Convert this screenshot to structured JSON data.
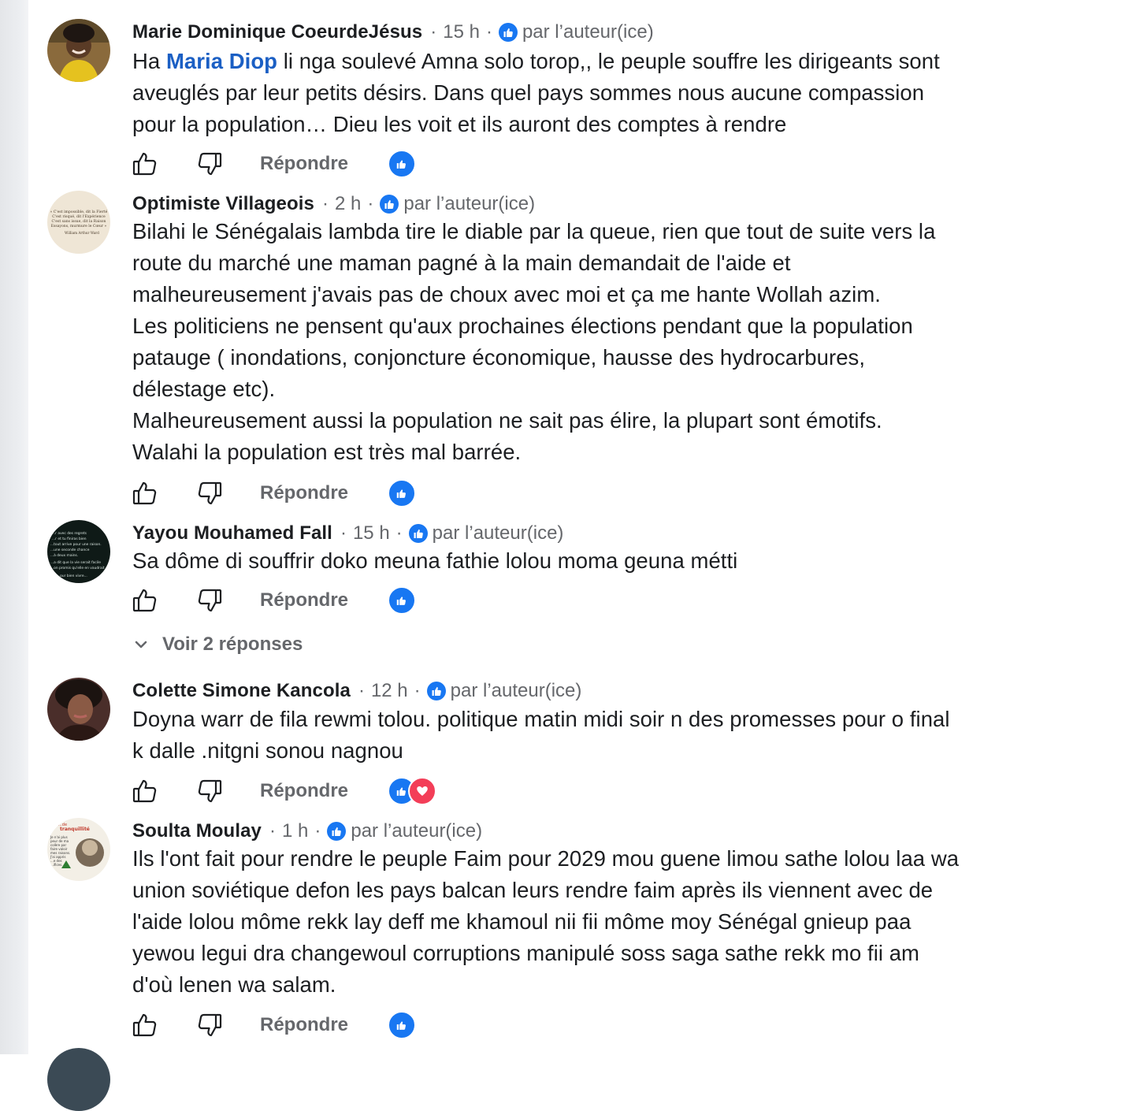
{
  "badge_text": "par l’auteur(ice)",
  "separator": "·",
  "reply_label": "Répondre",
  "colors": {
    "brand_blue": "#1877f2",
    "mention": "#1b5fc4",
    "meta_gray": "#65676b",
    "love_red": "#f33e58"
  },
  "avatar_art": {
    "quote": [
      "« C'est impossible, dit la Fierté",
      "C'est risqué, dit l'Expérience",
      "C'est sans issue, dit la Raison",
      "Essayons, murmure le Cœur »",
      "William Arthur Ward"
    ],
    "board": [
      "...r avec des regrets",
      "...r et tu finiras bien",
      "...tout arrive pour une raison.",
      "...une seconde chance",
      "...à deux mains.",
      "...a dit que la vie serait facile",
      "...on promis qu'elle en vaudrait",
      "...our bien vivre..."
    ],
    "poster": [
      "...de",
      "tranquillité",
      "Je n'ai plus",
      "peur de ma",
      "colère par",
      "faire valoir",
      "mes raisons.",
      "J'ai appris",
      "...e des",
      "...ifices."
    ]
  },
  "comments": [
    {
      "author": "Marie Dominique CoeurdeJésus",
      "time": "15 h",
      "lines": [
        {
          "pre": "Ha ",
          "mention": "Maria Diop",
          "post": " li nga soulevé Amna solo torop,, le peuple souffre les dirigeants sont"
        },
        {
          "pre": "aveuglés par leur petits désirs. Dans quel pays sommes nous aucune compassion"
        },
        {
          "pre": "pour la population… Dieu les voit et ils auront des comptes à rendre"
        }
      ],
      "reactions": [
        "like"
      ]
    },
    {
      "author": "Optimiste Villageois",
      "time": "2 h",
      "lines": [
        {
          "pre": "Bilahi le Sénégalais lambda tire le diable par la queue, rien que tout de suite vers la"
        },
        {
          "pre": "route du marché une maman pagné à la main demandait de l'aide et"
        },
        {
          "pre": "malheureusement j'avais pas de choux avec moi et ça me hante Wollah azim."
        },
        {
          "pre": "Les politiciens ne pensent qu'aux prochaines élections pendant que la population"
        },
        {
          "pre": "patauge ( inondations, conjoncture économique, hausse des hydrocarbures,"
        },
        {
          "pre": "délestage etc)."
        },
        {
          "pre": "Malheureusement aussi la population ne sait pas élire, la plupart sont émotifs."
        },
        {
          "pre": "Walahi la population est très mal barrée."
        }
      ],
      "reactions": [
        "like"
      ]
    },
    {
      "author": "Yayou Mouhamed Fall",
      "time": "15 h",
      "lines": [
        {
          "pre": "Sa dôme di souffrir doko meuna fathie lolou moma geuna métti"
        }
      ],
      "reactions": [
        "like"
      ],
      "replies_label": "Voir 2 réponses"
    },
    {
      "author": "Colette Simone Kancola",
      "time": "12 h",
      "lines": [
        {
          "pre": "Doyna warr de fila rewmi tolou. politique matin midi soir n des promesses pour o final"
        },
        {
          "pre": "k dalle .nitgni sonou nagnou"
        }
      ],
      "reactions": [
        "like",
        "love"
      ]
    },
    {
      "author": "Soulta Moulay",
      "time": "1 h",
      "lines": [
        {
          "pre": "Ils l'ont fait pour rendre le peuple Faim pour 2029 mou guene limou sathe lolou laa wa"
        },
        {
          "pre": "union soviétique defon les pays balcan leurs rendre faim après ils viennent avec de"
        },
        {
          "pre": "l'aide lolou môme rekk lay deff me khamoul nii fii môme moy Sénégal gnieup paa"
        },
        {
          "pre": "yewou legui dra changewoul corruptions manipulé soss saga sathe rekk mo fii am"
        },
        {
          "pre": "d'où lenen wa salam."
        }
      ],
      "reactions": [
        "like"
      ]
    }
  ]
}
